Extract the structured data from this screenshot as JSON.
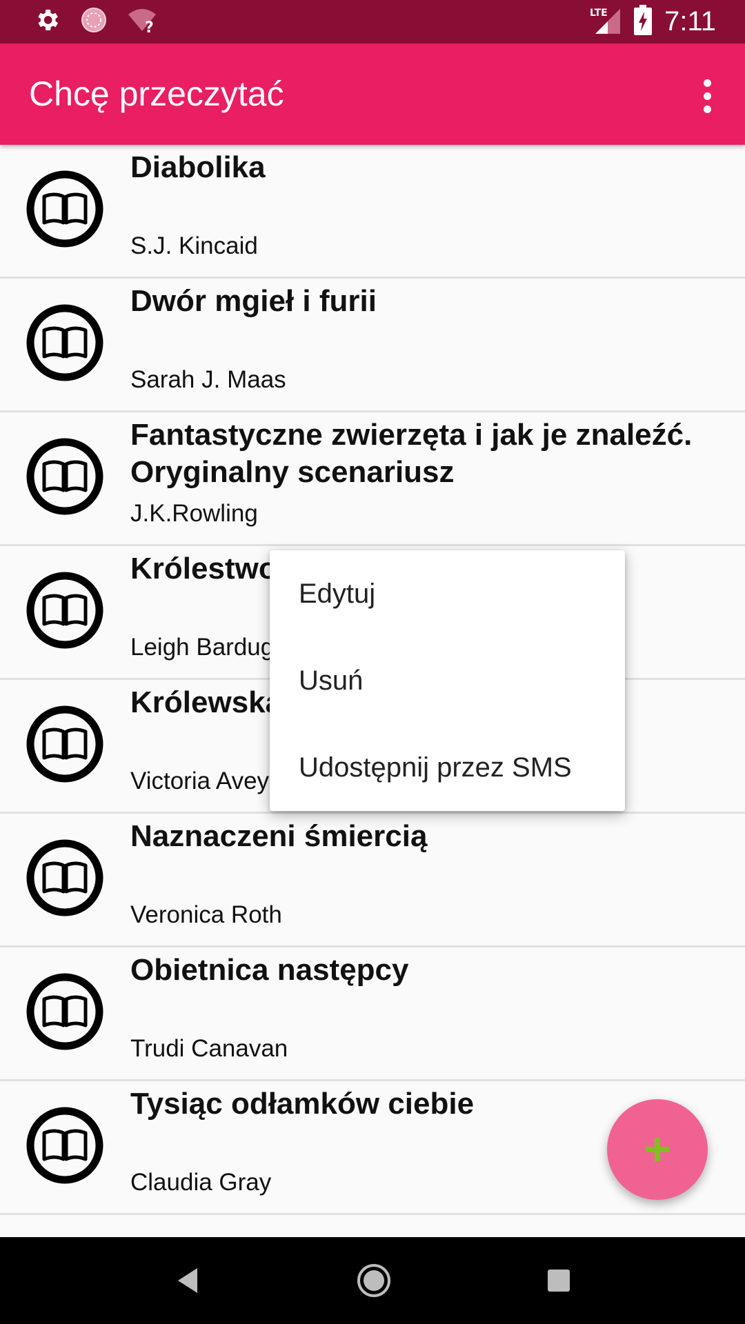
{
  "status_bar": {
    "time": "7:11",
    "network": "LTE",
    "icons": [
      "gear-icon",
      "sync-icon",
      "wifi-unknown-icon",
      "lte-signal-icon",
      "battery-charging-icon"
    ]
  },
  "app_bar": {
    "title": "Chcę przeczytać",
    "overflow_icon": "more-vert-icon"
  },
  "books": [
    {
      "title": "Diabolika",
      "author": "S.J. Kincaid"
    },
    {
      "title": "Dwór mgieł i furii",
      "author": "Sarah J. Maas"
    },
    {
      "title": "Fantastyczne zwierzęta i jak je znaleźć. Oryginalny scenariusz",
      "author": "J.K.Rowling"
    },
    {
      "title": "Królestwo",
      "author": "Leigh Bardug"
    },
    {
      "title": "Królewska",
      "author": "Victoria Avey"
    },
    {
      "title": "Naznaczeni śmiercią",
      "author": "Veronica Roth"
    },
    {
      "title": "Obietnica następcy",
      "author": "Trudi Canavan"
    },
    {
      "title": "Tysiąc odłamków ciebie",
      "author": "Claudia Gray"
    }
  ],
  "context_menu": {
    "items": [
      "Edytuj",
      "Usuń",
      "Udostępnij przez SMS"
    ]
  },
  "fab": {
    "icon": "plus-icon",
    "color": "#f06292"
  },
  "nav_bar": {
    "icons": [
      "back-icon",
      "home-icon",
      "recents-icon"
    ]
  },
  "colors": {
    "primary": "#e91e63",
    "primary_dark": "#880e35",
    "accent": "#f06292"
  }
}
